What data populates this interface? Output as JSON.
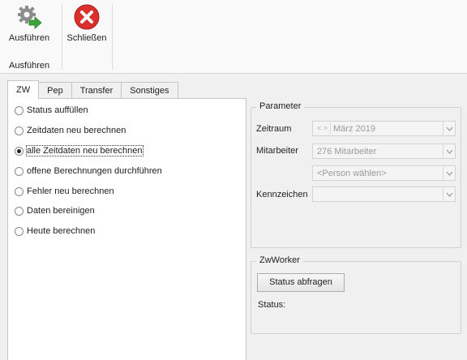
{
  "ribbon": {
    "run_label": "Ausführen",
    "close_label": "Schließen",
    "group_label": "Ausführen"
  },
  "tabs": [
    {
      "label": "ZW",
      "active": true
    },
    {
      "label": "Pep"
    },
    {
      "label": "Transfer"
    },
    {
      "label": "Sonstiges"
    }
  ],
  "options": [
    {
      "label": "Status auffüllen",
      "checked": false
    },
    {
      "label": "Zeitdaten neu berechnen",
      "checked": false
    },
    {
      "label": "alle Zeitdaten neu berechnen",
      "checked": true
    },
    {
      "label": "offene Berechnungen durchführen",
      "checked": false
    },
    {
      "label": "Fehler neu berechnen",
      "checked": false
    },
    {
      "label": "Daten bereinigen",
      "checked": false
    },
    {
      "label": "Heute berechnen",
      "checked": false
    }
  ],
  "parameter": {
    "title": "Parameter",
    "zeitraum_label": "Zeitraum",
    "zeitraum_prefix": "< >",
    "zeitraum_value": "März 2019",
    "mitarbeiter_label": "Mitarbeiter",
    "mitarbeiter_value": "276 Mitarbeiter",
    "person_placeholder": "<Person wählen>",
    "kennzeichen_label": "Kennzeichen",
    "kennzeichen_value": ""
  },
  "zwworker": {
    "title": "ZwWorker",
    "button_label": "Status abfragen",
    "status_label": "Status:"
  },
  "colors": {
    "close_red": "#d9302b",
    "gear_gray": "#8c8c8c",
    "arrow_green": "#3aa53a"
  }
}
